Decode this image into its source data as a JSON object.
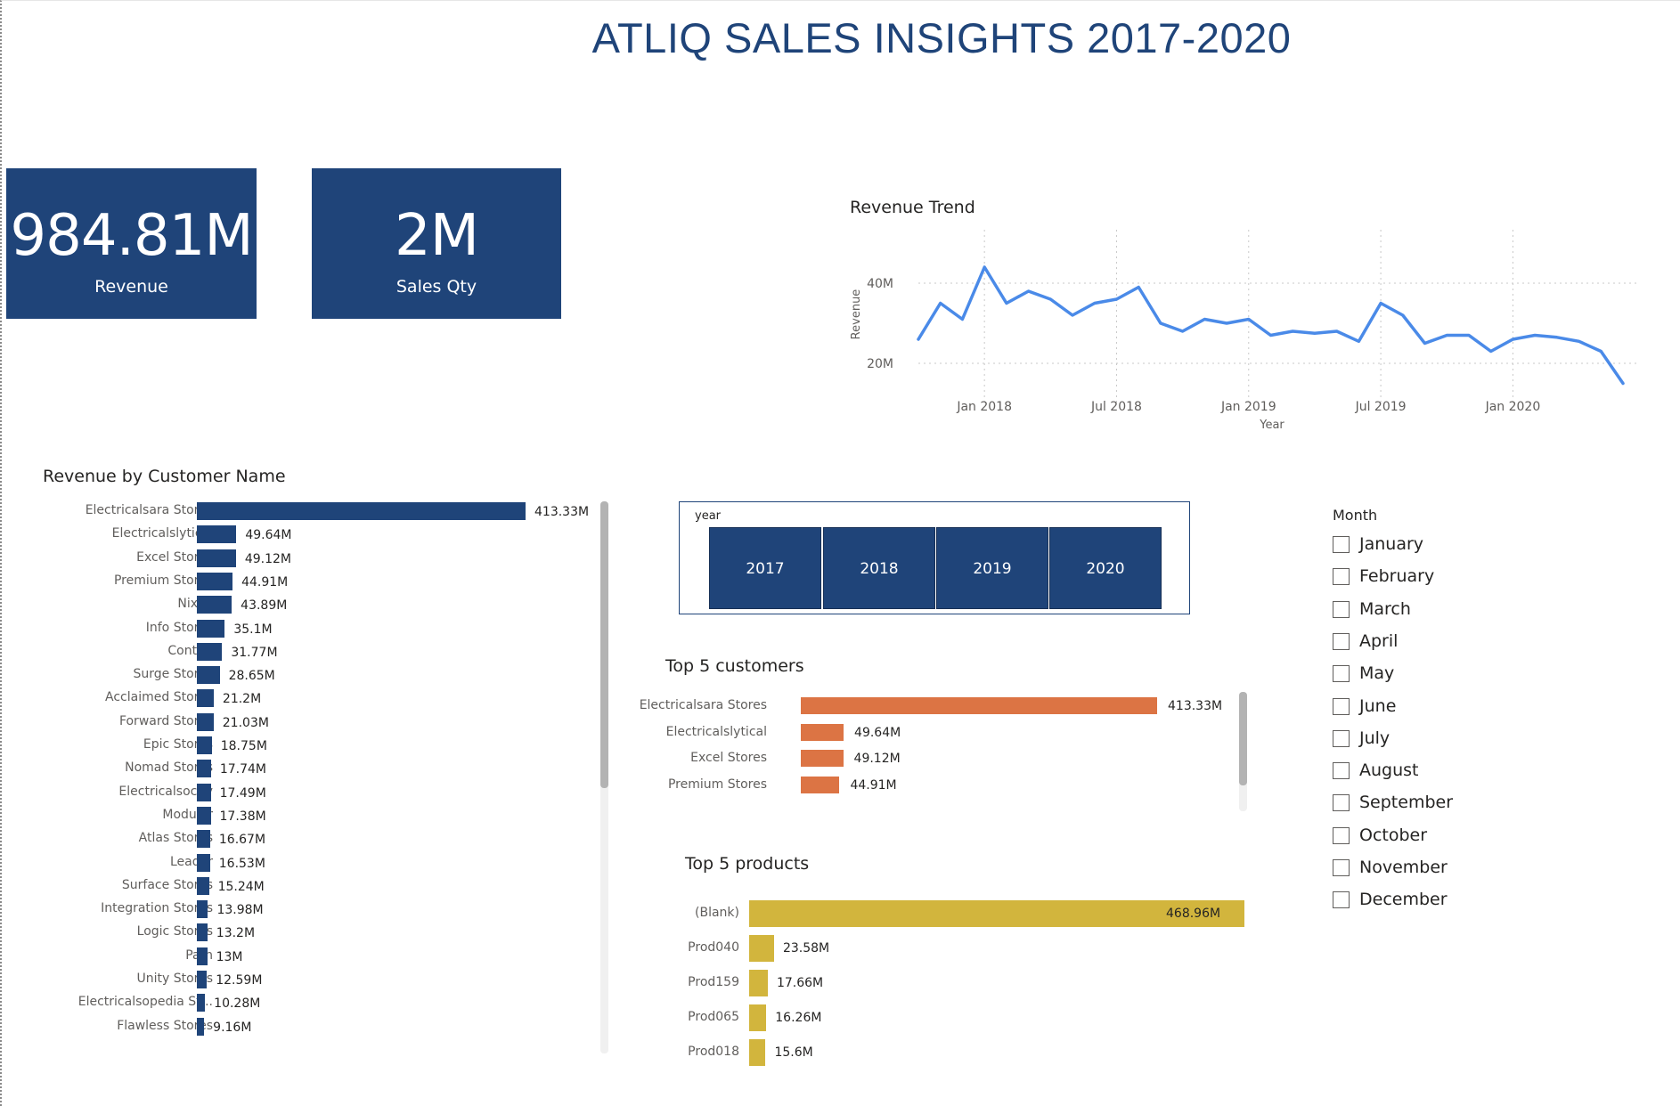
{
  "report": {
    "title": "ATLIQ SALES INSIGHTS 2017-2020"
  },
  "cards": {
    "revenue": {
      "value": "984.81M",
      "label": "Revenue"
    },
    "sales_qty": {
      "value": "2M",
      "label": "Sales Qty"
    }
  },
  "colors": {
    "primary": "#1f4479",
    "trend_line": "#4a8ae8",
    "top_customers": "#dc7444",
    "top_products": "#d2b53d"
  },
  "revenue_trend": {
    "title": "Revenue Trend",
    "y_ticks": [
      "40M",
      "20M"
    ],
    "x_ticks": [
      "Jan 2018",
      "Jul 2018",
      "Jan 2019",
      "Jul 2019",
      "Jan 2020"
    ],
    "y_axis_label": "Revenue",
    "x_axis_label": "Year"
  },
  "chart_data": [
    {
      "type": "line",
      "title": "Revenue Trend",
      "xlabel": "Year",
      "ylabel": "Revenue",
      "x": [
        "2017-10",
        "2017-11",
        "2017-12",
        "2018-01",
        "2018-02",
        "2018-03",
        "2018-04",
        "2018-05",
        "2018-06",
        "2018-07",
        "2018-08",
        "2018-09",
        "2018-10",
        "2018-11",
        "2018-12",
        "2019-01",
        "2019-02",
        "2019-03",
        "2019-04",
        "2019-05",
        "2019-06",
        "2019-07",
        "2019-08",
        "2019-09",
        "2019-10",
        "2019-11",
        "2019-12",
        "2020-01",
        "2020-02",
        "2020-03",
        "2020-04",
        "2020-05",
        "2020-06"
      ],
      "series": [
        {
          "values": [
            26,
            35,
            31,
            44,
            35,
            38,
            36,
            32,
            35,
            36,
            39,
            30,
            28,
            31,
            30,
            31,
            27,
            28,
            27.5,
            28,
            25.5,
            35,
            32,
            25,
            27,
            27,
            23,
            26,
            27,
            26.5,
            25.5,
            23,
            15
          ]
        }
      ],
      "ylim": [
        10,
        50
      ],
      "y_ticks": [
        20,
        40
      ],
      "grid": true
    },
    {
      "type": "bar",
      "title": "Revenue by Customer Name",
      "categories": [
        "Electricalsara Stores",
        "Electricalslytical",
        "Excel Stores",
        "Premium Stores",
        "Nixon",
        "Info Stores",
        "Control",
        "Surge Stores",
        "Acclaimed Stores",
        "Forward Stores",
        "Epic Stores",
        "Nomad Stores",
        "Electricalsocity",
        "Modular",
        "Atlas Stores",
        "Leader",
        "Surface Stores",
        "Integration Stores",
        "Logic Stores",
        "Path",
        "Unity Stores",
        "Electricalsopedia St...",
        "Flawless Stores"
      ],
      "values": [
        413.33,
        49.64,
        49.12,
        44.91,
        43.89,
        35.1,
        31.77,
        28.65,
        21.2,
        21.03,
        18.75,
        17.74,
        17.49,
        17.38,
        16.67,
        16.53,
        15.24,
        13.98,
        13.2,
        13,
        12.59,
        10.28,
        9.16
      ],
      "labels": [
        "413.33M",
        "49.64M",
        "49.12M",
        "44.91M",
        "43.89M",
        "35.1M",
        "31.77M",
        "28.65M",
        "21.2M",
        "21.03M",
        "18.75M",
        "17.74M",
        "17.49M",
        "17.38M",
        "16.67M",
        "16.53M",
        "15.24M",
        "13.98M",
        "13.2M",
        "13M",
        "12.59M",
        "10.28M",
        "9.16M"
      ]
    },
    {
      "type": "bar",
      "title": "Top 5 customers",
      "categories": [
        "Electricalsara Stores",
        "Electricalslytical",
        "Excel Stores",
        "Premium Stores"
      ],
      "values": [
        413.33,
        49.64,
        49.12,
        44.91
      ],
      "labels": [
        "413.33M",
        "49.64M",
        "49.12M",
        "44.91M"
      ]
    },
    {
      "type": "bar",
      "title": "Top 5 products",
      "categories": [
        "(Blank)",
        "Prod040",
        "Prod159",
        "Prod065",
        "Prod018"
      ],
      "values": [
        468.96,
        23.58,
        17.66,
        16.26,
        15.6
      ],
      "labels": [
        "468.96M",
        "23.58M",
        "17.66M",
        "16.26M",
        "15.6M"
      ]
    }
  ],
  "customer_chart": {
    "title": "Revenue by Customer Name",
    "scroll_fraction": 0.52
  },
  "top5_customers": {
    "title": "Top 5 customers",
    "scroll_fraction": 0.78
  },
  "top5_products": {
    "title": "Top 5 products"
  },
  "year_slicer": {
    "label": "year",
    "options": [
      "2017",
      "2018",
      "2019",
      "2020"
    ]
  },
  "month_slicer": {
    "title": "Month",
    "options": [
      "January",
      "February",
      "March",
      "April",
      "May",
      "June",
      "July",
      "August",
      "September",
      "October",
      "November",
      "December"
    ]
  }
}
